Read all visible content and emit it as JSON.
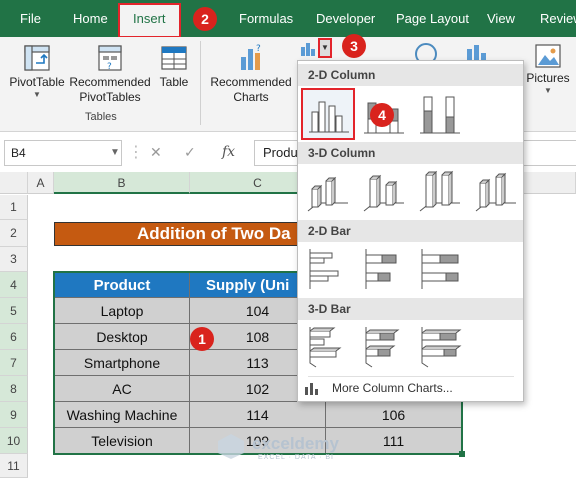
{
  "tabs": {
    "file": "File",
    "home": "Home",
    "insert": "Insert",
    "formulas": "Formulas",
    "developer": "Developer",
    "page_layout": "Page Layout",
    "view": "View",
    "review": "Review"
  },
  "ribbon": {
    "pivottable": "PivotTable",
    "recommended_pivottables_1": "Recommended",
    "recommended_pivottables_2": "PivotTables",
    "table": "Table",
    "tables_group": "Tables",
    "recommended_charts_1": "Recommended",
    "recommended_charts_2": "Charts",
    "pictures": "Pictures"
  },
  "steps": [
    "1",
    "2",
    "3",
    "4"
  ],
  "formula_bar": {
    "name_box": "B4",
    "fx": "fx",
    "content": "Product"
  },
  "columns": [
    "A",
    "B",
    "C"
  ],
  "rows": [
    "1",
    "2",
    "3",
    "4",
    "5",
    "6",
    "7",
    "8",
    "9",
    "10",
    "11"
  ],
  "sheet": {
    "title": "Addition of Two Da",
    "headers": [
      "Product",
      "Supply (Uni"
    ],
    "data": [
      [
        "Laptop",
        "104",
        ""
      ],
      [
        "Desktop",
        "108",
        ""
      ],
      [
        "Smartphone",
        "113",
        ""
      ],
      [
        "AC",
        "102",
        ""
      ],
      [
        "Washing Machine",
        "114",
        "106"
      ],
      [
        "Television",
        "109",
        "111"
      ]
    ]
  },
  "dropdown": {
    "section_2d_column": "2-D Column",
    "section_3d_column": "3-D Column",
    "section_2d_bar": "2-D Bar",
    "section_3d_bar": "3-D Bar",
    "more": "More Column Charts..."
  },
  "watermark": "exceldemy",
  "watermark_sub": "EXCEL · DATA · BI",
  "colors": {
    "excel_green": "#217346",
    "title_fill": "#c55a11",
    "header_fill": "#1f78c1",
    "row_fill": "#d0d0d0",
    "step_red": "#d9231d"
  }
}
